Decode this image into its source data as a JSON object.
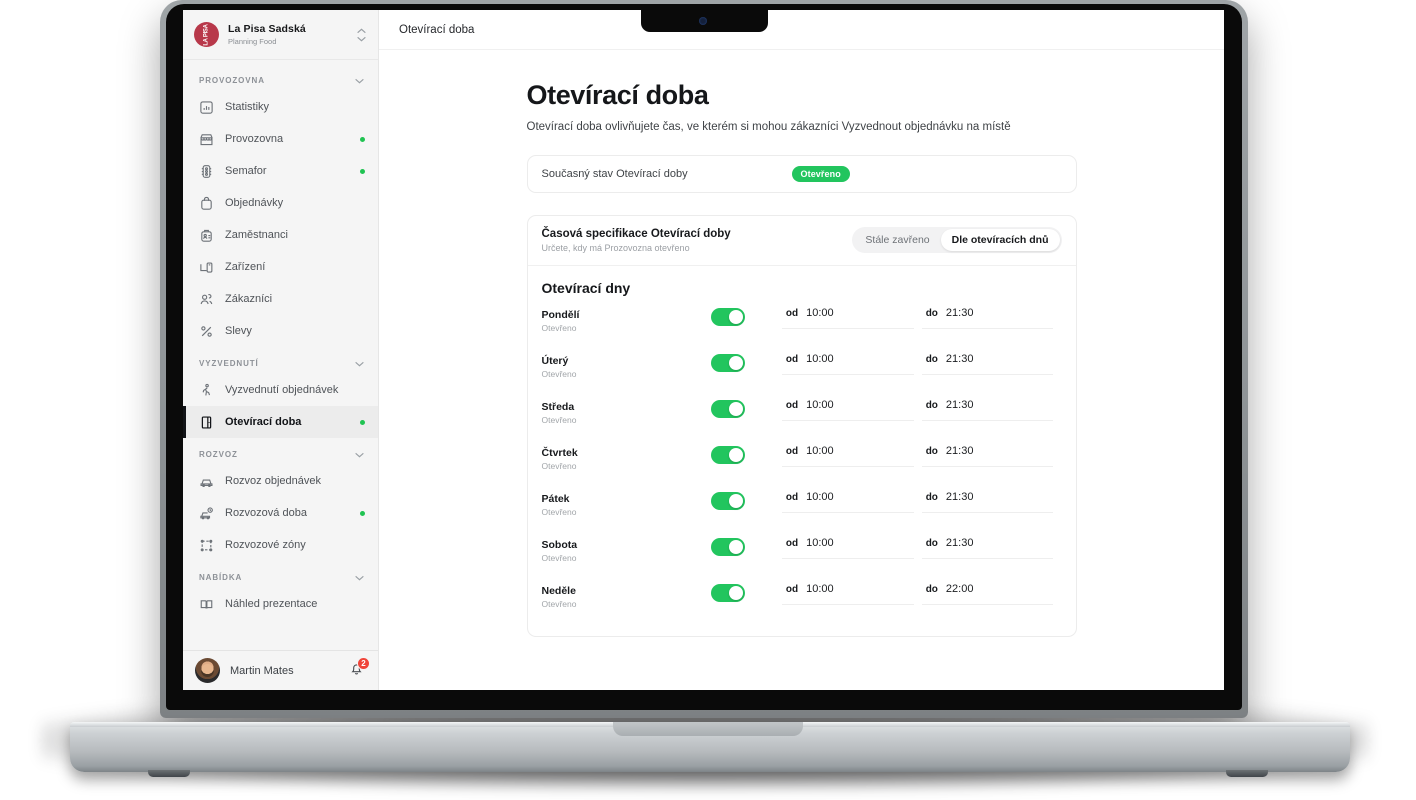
{
  "sidebar": {
    "org": {
      "name": "La Pisa Sadská",
      "subtitle": "Planning Food",
      "logo_text": "LA PISA",
      "switcher_icon": "chevron-up-down-icon"
    },
    "sections": [
      {
        "label": "PROVOZOVNA",
        "collapse_icon": "chevron-down-icon",
        "items": [
          {
            "label": "Statistiky",
            "icon": "bar-chart-icon",
            "dot": false,
            "active": false
          },
          {
            "label": "Provozovna",
            "icon": "store-icon",
            "dot": true,
            "active": false
          },
          {
            "label": "Semafor",
            "icon": "traffic-light-icon",
            "dot": true,
            "active": false
          },
          {
            "label": "Objednávky",
            "icon": "bag-icon",
            "dot": false,
            "active": false
          },
          {
            "label": "Zaměstnanci",
            "icon": "id-badge-icon",
            "dot": false,
            "active": false
          },
          {
            "label": "Zařízení",
            "icon": "device-icon",
            "dot": false,
            "active": false
          },
          {
            "label": "Zákazníci",
            "icon": "users-icon",
            "dot": false,
            "active": false
          },
          {
            "label": "Slevy",
            "icon": "percent-icon",
            "dot": false,
            "active": false
          }
        ]
      },
      {
        "label": "VYZVEDNUTÍ",
        "collapse_icon": "chevron-down-icon",
        "items": [
          {
            "label": "Vyzvednutí objednávek",
            "icon": "walking-person-icon",
            "dot": false,
            "active": false
          },
          {
            "label": "Otevírací doba",
            "icon": "door-icon",
            "dot": true,
            "active": true
          }
        ]
      },
      {
        "label": "ROZVOZ",
        "collapse_icon": "chevron-down-icon",
        "items": [
          {
            "label": "Rozvoz objednávek",
            "icon": "car-icon",
            "dot": false,
            "active": false
          },
          {
            "label": "Rozvozová doba",
            "icon": "car-clock-icon",
            "dot": true,
            "active": false
          },
          {
            "label": "Rozvozové zóny",
            "icon": "zone-square-icon",
            "dot": false,
            "active": false
          }
        ]
      },
      {
        "label": "NABÍDKA",
        "collapse_icon": "chevron-down-icon",
        "items": [
          {
            "label": "Náhled prezentace",
            "icon": "book-icon",
            "dot": false,
            "active": false
          }
        ]
      }
    ],
    "user": {
      "name": "Martin Mates",
      "avatar_icon": "user-avatar",
      "bell_icon": "bell-icon",
      "notification_count": "2"
    }
  },
  "topbar": {
    "breadcrumb": "Otevírací doba"
  },
  "page": {
    "title": "Otevírací doba",
    "description": "Otevírací doba ovlivňujete čas, ve kterém si mohou zákazníci Vyzvednout objednávku na místě"
  },
  "status_card": {
    "label": "Současný stav Otevírací doby",
    "badge": "Otevřeno",
    "badge_color": "#22c55e"
  },
  "panel": {
    "title": "Časová specifikace Otevírací doby",
    "subtitle": "Určete, kdy má Prozovozna otevřeno",
    "segmented": {
      "options": [
        "Stále zavřeno",
        "Dle otevíracích dnů"
      ],
      "selected": "Dle otevíracích dnů"
    },
    "days_title": "Otevírací dny",
    "from_label": "od",
    "to_label": "do",
    "days": [
      {
        "name": "Pondělí",
        "state": "Otevřeno",
        "enabled": true,
        "from": "10:00",
        "to": "21:30"
      },
      {
        "name": "Úterý",
        "state": "Otevřeno",
        "enabled": true,
        "from": "10:00",
        "to": "21:30"
      },
      {
        "name": "Středa",
        "state": "Otevřeno",
        "enabled": true,
        "from": "10:00",
        "to": "21:30"
      },
      {
        "name": "Čtvrtek",
        "state": "Otevřeno",
        "enabled": true,
        "from": "10:00",
        "to": "21:30"
      },
      {
        "name": "Pátek",
        "state": "Otevřeno",
        "enabled": true,
        "from": "10:00",
        "to": "21:30"
      },
      {
        "name": "Sobota",
        "state": "Otevřeno",
        "enabled": true,
        "from": "10:00",
        "to": "21:30"
      },
      {
        "name": "Neděle",
        "state": "Otevřeno",
        "enabled": true,
        "from": "10:00",
        "to": "22:00"
      }
    ]
  },
  "device": {
    "camera_icon": "webcam-icon"
  }
}
